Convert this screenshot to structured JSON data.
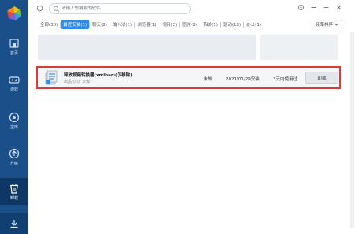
{
  "sidebar": {
    "items": [
      {
        "label": "首页",
        "icon": "home-icon"
      },
      {
        "label": "游戏",
        "icon": "gamepad-icon"
      },
      {
        "label": "宝库",
        "icon": "treasury-icon"
      },
      {
        "label": "升级",
        "icon": "upgrade-icon"
      },
      {
        "label": "卸载",
        "icon": "trash-icon"
      }
    ],
    "bottom_icon": "download-icon"
  },
  "search": {
    "placeholder": "请输入想搜索的软件"
  },
  "tabs": [
    "全部(30)",
    "最近安装(1)",
    "聊天(2)",
    "输入法(1)",
    "浏览器(1)",
    "视频(2)",
    "图片(2)",
    "系统(1)",
    "驱动(13)",
    "办公(1)"
  ],
  "sort": {
    "label": "频率排序"
  },
  "app": {
    "name": "释放视频转换器(xmlbar)(仅移除)",
    "publisher": "出品公司: 未知",
    "size": "未知",
    "install_date": "2021/01/29安装",
    "usage": "3天内使用过",
    "action_label": "卸载"
  },
  "colors": {
    "sidebar": "#1b4f8a",
    "accent": "#2d8ce6",
    "highlight_border": "#d93b3b"
  }
}
